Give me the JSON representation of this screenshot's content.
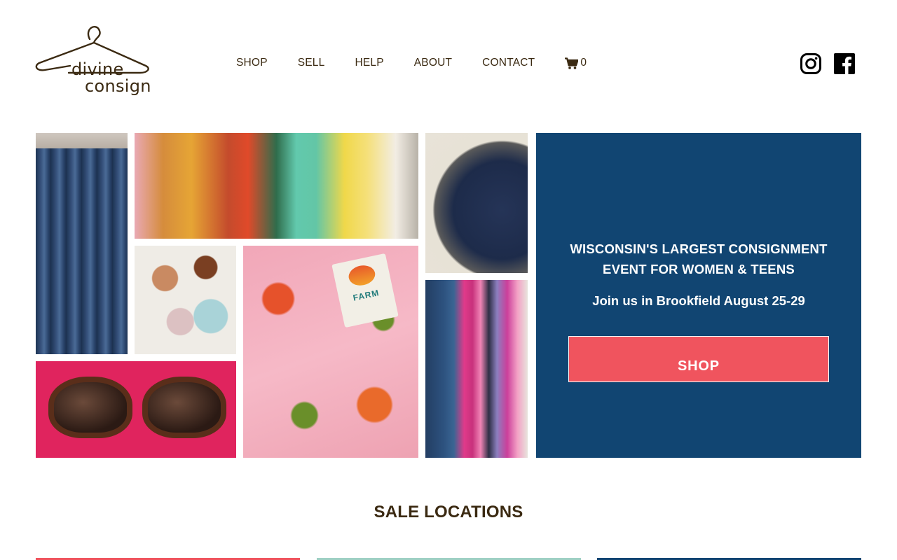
{
  "brand": {
    "line1": "divine",
    "line2": "consign"
  },
  "nav": {
    "items": [
      {
        "label": "SHOP"
      },
      {
        "label": "SELL"
      },
      {
        "label": "HELP"
      },
      {
        "label": "ABOUT"
      },
      {
        "label": "CONTACT"
      }
    ],
    "cart_count": "0",
    "cart_icon": "shopping-cart-icon"
  },
  "social": {
    "icons": [
      "instagram-icon",
      "facebook-icon"
    ]
  },
  "collage": {
    "tiles": [
      "jeans-photo",
      "colorful-tops-photo",
      "handbag-photo",
      "shoes-photo",
      "floral-dress-photo",
      "clothing-rack-photo",
      "sunglasses-photo"
    ],
    "dress_tag_text": "FARM"
  },
  "promo": {
    "headline_line1": "WISCONSIN'S LARGEST CONSIGNMENT",
    "headline_line2": "EVENT FOR WOMEN & TEENS",
    "subtext": "Join us in Brookfield August 25-29",
    "button_label": "SHOP"
  },
  "sale_locations": {
    "title": "SALE LOCATIONS"
  },
  "colors": {
    "navy": "#114572",
    "coral": "#f0545e",
    "mint": "#9fd0c4",
    "brown": "#3b2a12"
  }
}
